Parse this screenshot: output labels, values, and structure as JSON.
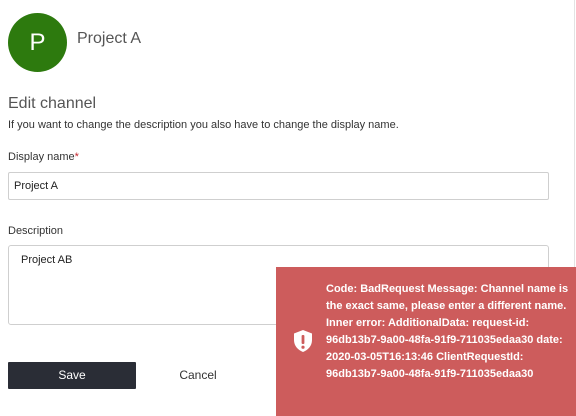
{
  "header": {
    "avatar_letter": "P",
    "avatar_color": "#2d7a0e",
    "project_name": "Project A"
  },
  "panel": {
    "title": "Edit channel",
    "subtitle": "If you want to change the description you also have to change the display name."
  },
  "form": {
    "display_name_label": "Display name",
    "required_marker": "*",
    "display_name_value": "Project A",
    "description_label": "Description",
    "description_value": "Project AB"
  },
  "actions": {
    "save_label": "Save",
    "cancel_label": "Cancel"
  },
  "error_toast": {
    "icon": "shield-exclamation-icon",
    "background": "#cd5c5c",
    "message": "Code: BadRequest Message: Channel name is the exact same, please enter a different name. Inner error: AdditionalData: request-id: 96db13b7-9a00-48fa-91f9-711035edaa30 date: 2020-03-05T16:13:46 ClientRequestId: 96db13b7-9a00-48fa-91f9-711035edaa30"
  }
}
